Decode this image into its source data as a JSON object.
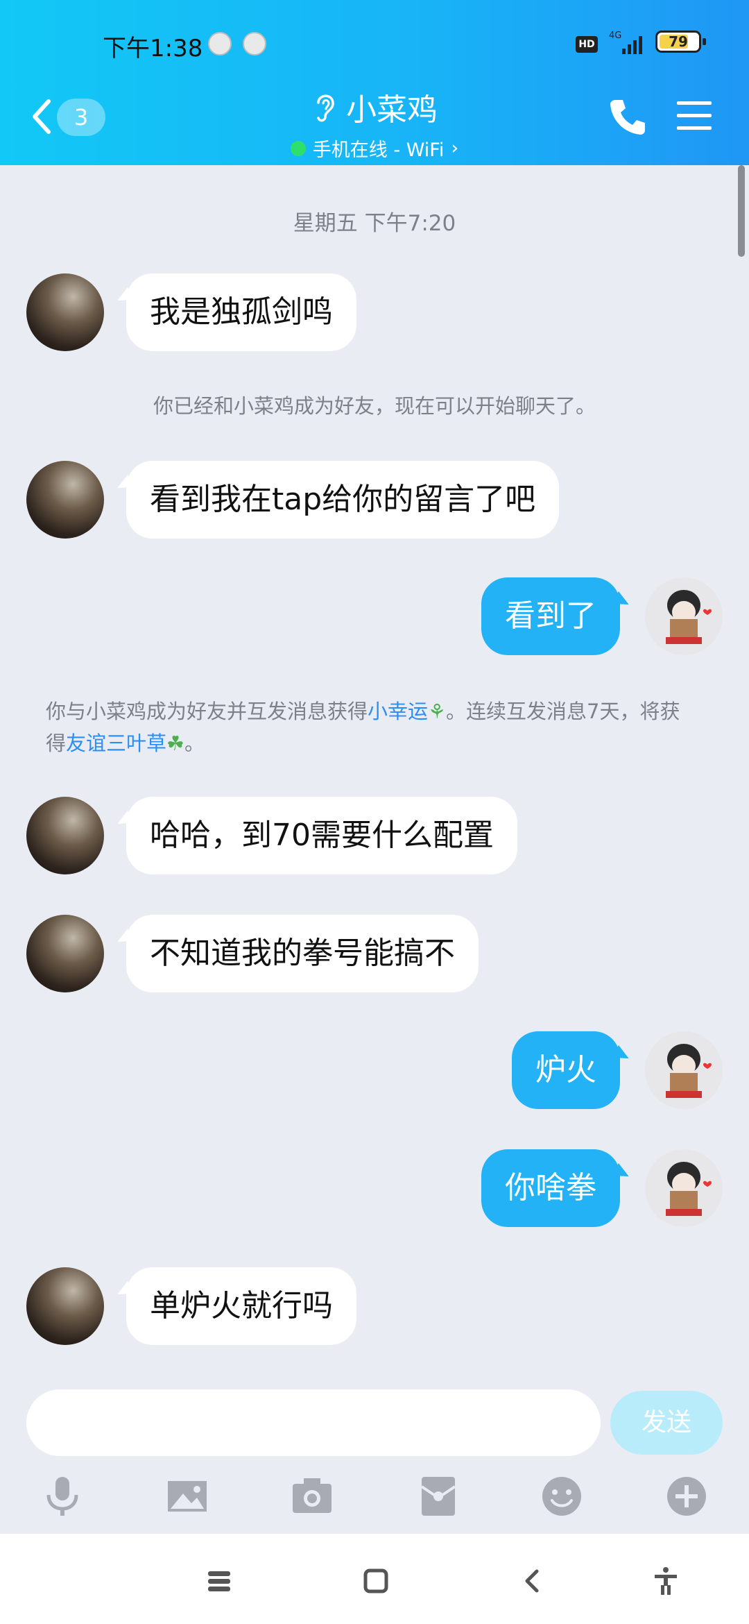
{
  "status_bar": {
    "time": "下午1:38",
    "hd_label": "HD",
    "network_label": "4G",
    "battery_percent": 79,
    "battery_label": "79"
  },
  "header": {
    "unread_count": "3",
    "title": "小菜鸡",
    "status": "手机在线 - WiFi",
    "status_chevron": "›"
  },
  "messages": {
    "timestamp": "星期五 下午7:20",
    "m1": "我是独孤剑鸣",
    "sys1": "你已经和小菜鸡成为好友，现在可以开始聊天了。",
    "m2": "看到我在tap给你的留言了吧",
    "m3": "看到了",
    "sys2": {
      "part1": "你与小菜鸡成为好友并互发消息获得",
      "link1": "小幸运",
      "part2": "。连续互发消息7天，将获得",
      "link2": "友谊三叶草",
      "part3": "。"
    },
    "m4": "哈哈，到70需要什么配置",
    "m5": "不知道我的拳号能搞不",
    "m6": "炉火",
    "m7": "你啥拳",
    "m8": "单炉火就行吗"
  },
  "input": {
    "send_label": "发送"
  },
  "colors": {
    "header_start": "#12c8f6",
    "header_end": "#1f97f5",
    "outgoing_bubble": "#22b2f5",
    "send_button": "#b8ecfb",
    "link": "#2b8ef5"
  }
}
